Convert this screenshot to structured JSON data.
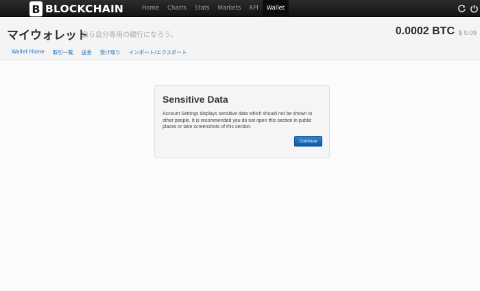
{
  "brand": {
    "name": "BLOCKCHAIN"
  },
  "nav": {
    "items": [
      {
        "label": "Home"
      },
      {
        "label": "Charts"
      },
      {
        "label": "Stats"
      },
      {
        "label": "Markets"
      },
      {
        "label": "API"
      },
      {
        "label": "Wallet",
        "active": true
      }
    ],
    "icons": [
      "refresh-icon",
      "power-icon"
    ]
  },
  "header": {
    "title": "マイウォレット",
    "subtitle": "自ら自分専用の銀行になろう。",
    "balance_btc": "0.0002 BTC",
    "balance_usd": "$ 0.09"
  },
  "subnav": {
    "items": [
      {
        "label": "Wallet Home"
      },
      {
        "label": "取引一覧"
      },
      {
        "label": "送金"
      },
      {
        "label": "受け取り"
      },
      {
        "label": "インポート/エクスポート"
      }
    ]
  },
  "modal": {
    "title": "Sensitive Data",
    "body": "Account Settings displays sensitive data which should not be shown to other people. It is recommended you do not open this section in public places or take screenshots of this section.",
    "button_label": "Continue"
  },
  "colors": {
    "topbar": "#1b1b1b",
    "link": "#1f6fb5",
    "primary_button": "#1a6fc2"
  }
}
